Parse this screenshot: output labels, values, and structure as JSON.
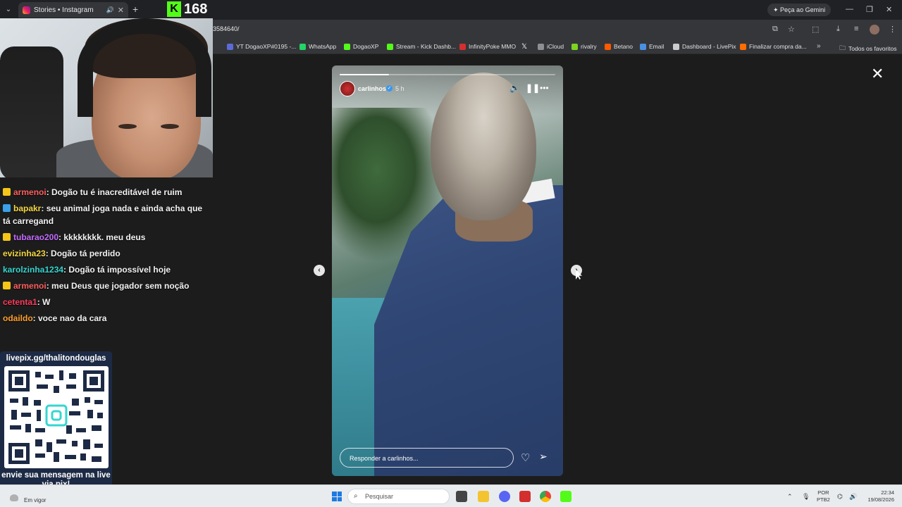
{
  "browser": {
    "tab_title": "Stories • Instagram",
    "gemini_label": "Peça ao Gemini",
    "url_fragment": "3584640/",
    "bookmarks": [
      {
        "label": "YT DogaoXP#0195 -...",
        "color": "#5b6bd6"
      },
      {
        "label": "WhatsApp",
        "color": "#25d366"
      },
      {
        "label": "DogaoXP",
        "color": "#53fc18"
      },
      {
        "label": "Stream - Kick Dashb...",
        "color": "#53fc18"
      },
      {
        "label": "InfinityPoke MMO",
        "color": "#d32f2f"
      },
      {
        "label": "",
        "color": "#000000"
      },
      {
        "label": "iCloud",
        "color": "#8e8e93"
      },
      {
        "label": "rivalry",
        "color": "#7cd321"
      },
      {
        "label": "Betano",
        "color": "#ff5a00"
      },
      {
        "label": "Email",
        "color": "#4a90e2"
      },
      {
        "label": "Dashboard - LivePix",
        "color": "#cccccc"
      },
      {
        "label": "Finalizar compra da...",
        "color": "#ff6d00"
      }
    ],
    "all_favorites": "Todos os favoritos"
  },
  "stream": {
    "viewer_count": "168",
    "kick_logo": "K"
  },
  "chat": [
    {
      "user": "armenoi",
      "color": "#ff5f5f",
      "badge": "#f5c518",
      "text": ": Dogão tu é inacreditável de ruim"
    },
    {
      "user": "bapakr",
      "color": "#f5d742",
      "badge": "#3aa0e8",
      "text": ": seu animal joga nada e ainda acha que tá carregand"
    },
    {
      "user": "tubarao200",
      "color": "#c46bff",
      "badge": "#f5c518",
      "text": ": kkkkkkkk. meu deus"
    },
    {
      "user": "evizinha23",
      "color": "#f5d742",
      "badge": "",
      "text": ": Dogão tá perdido"
    },
    {
      "user": "karolzinha1234",
      "color": "#35d6d1",
      "badge": "",
      "text": ": Dogão tá impossível hoje"
    },
    {
      "user": "armenoi",
      "color": "#ff5f5f",
      "badge": "#f5c518",
      "text": ": meu Deus que jogador sem noção"
    },
    {
      "user": "cetenta1",
      "color": "#ff3b5c",
      "badge": "",
      "text": ": W"
    },
    {
      "user": "odaildo",
      "color": "#ff9f2e",
      "badge": "",
      "text": ": voce nao da cara"
    }
  ],
  "qr_panel": {
    "url": "livepix.gg/thalitondouglas",
    "message": "envie sua mensagem na live via pix!"
  },
  "story": {
    "username": "carlinhos",
    "time": "5 h",
    "progress": 0.23,
    "reply_placeholder": "Responder a carlinhos..."
  },
  "taskbar": {
    "weather": "Em vigor",
    "search_placeholder": "Pesquisar",
    "lang_top": "POR",
    "lang_bottom": "PTB2",
    "time": "22:34",
    "date": "19/08/2026"
  }
}
